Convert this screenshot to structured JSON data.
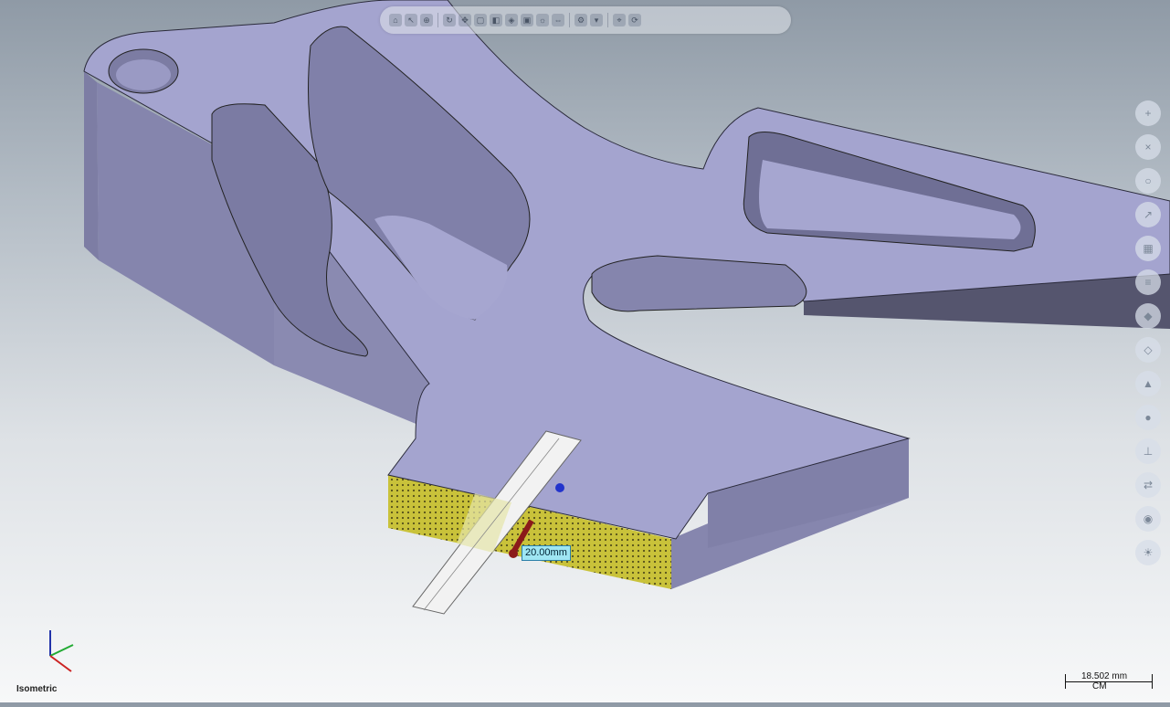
{
  "toolbar": {
    "buttons": [
      "home-icon",
      "select-icon",
      "zoom-icon",
      "rotate-icon",
      "pan-icon",
      "fit-icon",
      "section-icon",
      "view-icon",
      "display-icon",
      "light-icon",
      "measure-icon",
      "settings-icon",
      "filter-icon",
      "snap-icon",
      "refresh-icon"
    ]
  },
  "right_toolbar": {
    "buttons": [
      "plus-icon",
      "close-icon",
      "circle-icon",
      "arrow-icon",
      "grid-icon",
      "layers-icon",
      "cube-icon",
      "edge-icon",
      "face-icon",
      "color-icon",
      "axis-icon",
      "mirror-icon",
      "sphere-icon",
      "sun-icon",
      "reset-icon"
    ]
  },
  "measurement": {
    "label": "20.00mm"
  },
  "view": {
    "name": "Isometric"
  },
  "scale_bar": {
    "value": "18.502 mm",
    "unit": "CM"
  },
  "colors": {
    "part_face": "#a4a4cf",
    "part_side": "#8585ad",
    "section_fill": "#c9c23a",
    "ruler": "#f2f2f2"
  }
}
